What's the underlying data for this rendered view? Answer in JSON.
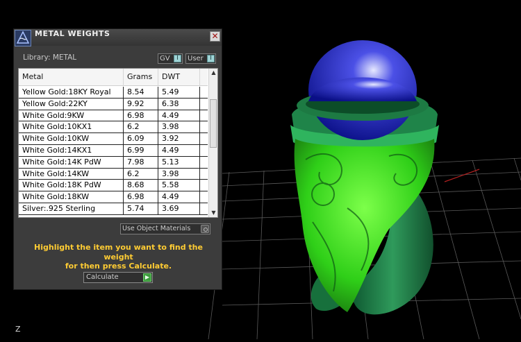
{
  "dialog": {
    "title": "METAL WEIGHTS",
    "close_glyph": "✕",
    "library_label": "Library: METAL",
    "toggle_gv": "GV",
    "toggle_user": "User",
    "toggle_knob": "I",
    "columns": [
      "Metal",
      "Grams",
      "DWT"
    ],
    "rows": [
      {
        "metal": "Yellow Gold:18KY Royal",
        "grams": "8.54",
        "dwt": "5.49"
      },
      {
        "metal": "Yellow Gold:22KY",
        "grams": "9.92",
        "dwt": "6.38"
      },
      {
        "metal": "White Gold:9KW",
        "grams": "6.98",
        "dwt": "4.49"
      },
      {
        "metal": "White Gold:10KX1",
        "grams": "6.2",
        "dwt": "3.98"
      },
      {
        "metal": "White Gold:10KW",
        "grams": "6.09",
        "dwt": "3.92"
      },
      {
        "metal": "White Gold:14KX1",
        "grams": "6.99",
        "dwt": "4.49"
      },
      {
        "metal": "White Gold:14K PdW",
        "grams": "7.98",
        "dwt": "5.13"
      },
      {
        "metal": "White Gold:14KW",
        "grams": "6.2",
        "dwt": "3.98"
      },
      {
        "metal": "White Gold:18K PdW",
        "grams": "8.68",
        "dwt": "5.58"
      },
      {
        "metal": "White Gold:18KW",
        "grams": "6.98",
        "dwt": "4.49"
      },
      {
        "metal": "Silver:.925 Sterling",
        "grams": "5.74",
        "dwt": "3.69"
      }
    ],
    "use_object_materials": "Use Object Materials",
    "hint_line1": "Highlight the item you want to find the weight",
    "hint_line2": "for then press Calculate.",
    "calculate_label": "Calculate",
    "scroll_up": "▲",
    "scroll_down": "▼"
  },
  "viewport": {
    "axis_label": "Z",
    "ring_color": "#2e9c5a",
    "highlight_color": "#39e619",
    "gem_color": "#1b22b8"
  }
}
